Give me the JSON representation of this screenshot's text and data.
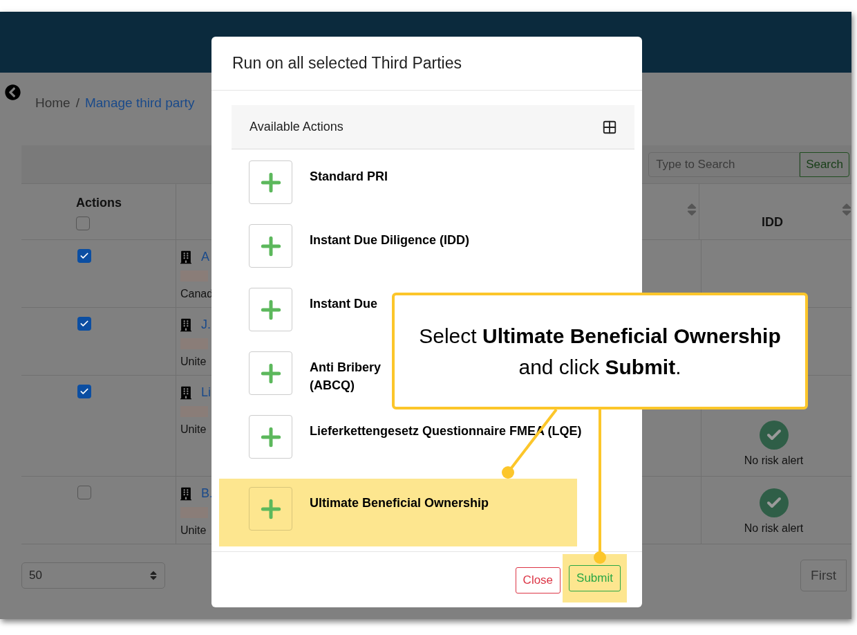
{
  "breadcrumb": [
    {
      "label": "Home",
      "kind": "text"
    },
    {
      "label": "/",
      "kind": "separator"
    },
    {
      "label": "Manage third party",
      "kind": "link"
    }
  ],
  "search": {
    "placeholder": "Type to Search",
    "button": "Search"
  },
  "table": {
    "columns": [
      "Actions",
      "IDD"
    ],
    "select_all_checked": false,
    "rows": [
      {
        "checked": true,
        "name": "A",
        "country": "Canad",
        "idd": null
      },
      {
        "checked": true,
        "name": "J.",
        "country": "Unite",
        "idd": null
      },
      {
        "checked": true,
        "name": "Li",
        "country": "Unite",
        "idd": "No risk alert"
      },
      {
        "checked": false,
        "name": "B.",
        "country": "Unite",
        "idd": "No risk alert"
      }
    ]
  },
  "pager": {
    "page_size": "50",
    "first": "First"
  },
  "modal": {
    "title": "Run on all selected Third Parties",
    "panel_title": "Available Actions",
    "actions": [
      {
        "label": "Standard PRI",
        "selected": false
      },
      {
        "label": "Instant Due Diligence (IDD)",
        "selected": false
      },
      {
        "label": "Instant Due",
        "selected": false
      },
      {
        "label": "Anti Bribery\n(ABCQ)",
        "selected": false
      },
      {
        "label": "Lieferkettengesetz Questionnaire FMEA (LQE)",
        "selected": false
      },
      {
        "label": "Ultimate Beneficial Ownership",
        "selected": true
      }
    ],
    "close": "Close",
    "submit": "Submit"
  },
  "callout": {
    "text": "Select **Ultimate Beneficial Ownership** and click **Submit**."
  }
}
